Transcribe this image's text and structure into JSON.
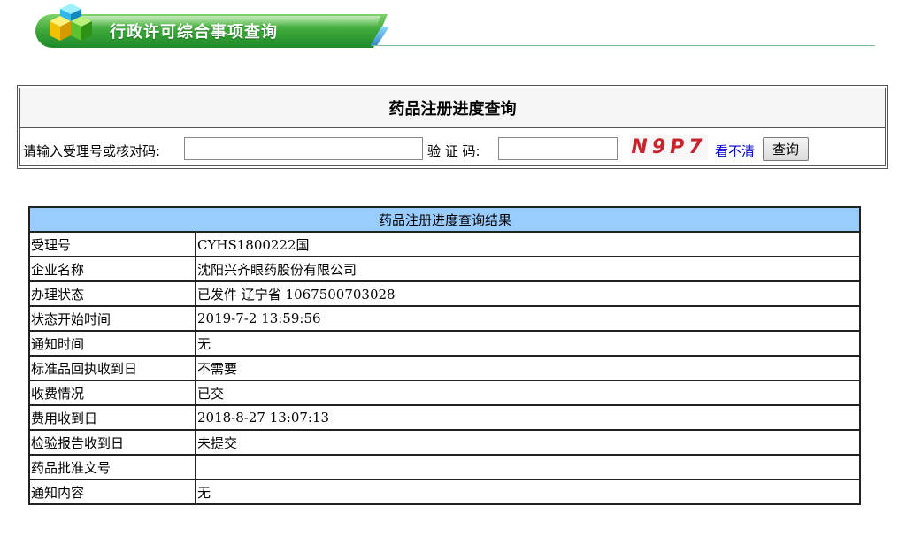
{
  "header": {
    "title": "行政许可综合事项查询"
  },
  "query": {
    "title": "药品注册进度查询",
    "accept_label": "请输入受理号或核对码:",
    "accept_value": "",
    "captcha_label": "验 证 码:",
    "captcha_value": "",
    "captcha_text": "N9P7",
    "refresh_link": "看不清",
    "submit_label": "查询"
  },
  "result": {
    "title": "药品注册进度查询结果",
    "rows": [
      {
        "label": "受理号",
        "value": "CYHS1800222国"
      },
      {
        "label": "企业名称",
        "value": "沈阳兴齐眼药股份有限公司"
      },
      {
        "label": "办理状态",
        "value": "已发件 辽宁省 1067500703028"
      },
      {
        "label": "状态开始时间",
        "value": "2019-7-2 13:59:56"
      },
      {
        "label": "通知时间",
        "value": "无"
      },
      {
        "label": "标准品回执收到日",
        "value": "不需要"
      },
      {
        "label": "收费情况",
        "value": "已交"
      },
      {
        "label": "费用收到日",
        "value": "2018-8-27 13:07:13"
      },
      {
        "label": "检验报告收到日",
        "value": "未提交"
      },
      {
        "label": "药品批准文号",
        "value": ""
      },
      {
        "label": "通知内容",
        "value": "无"
      }
    ]
  },
  "colors": {
    "banner_green": "#3da83a",
    "result_header_bg": "#99ccff",
    "captcha_red": "#c8242e",
    "link_blue": "#0000cc"
  },
  "icons": {
    "banner_logo": "cubes-icon"
  }
}
